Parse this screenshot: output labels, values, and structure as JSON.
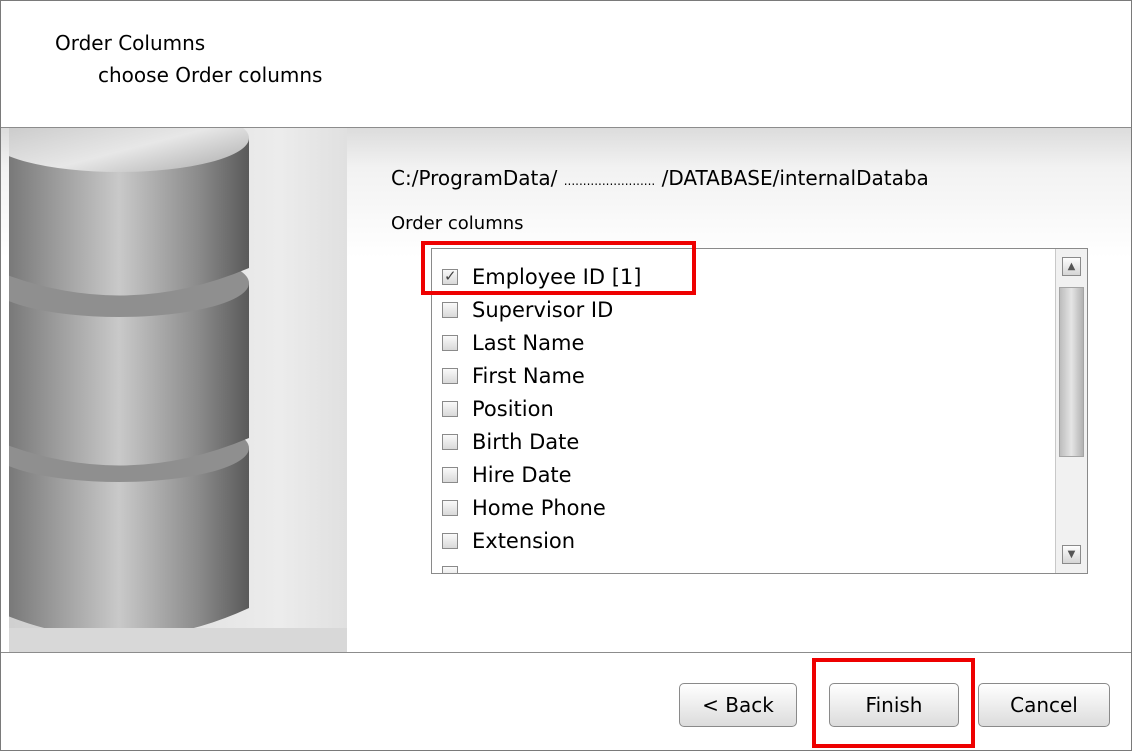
{
  "header": {
    "title": "Order Columns",
    "subtitle": "choose  Order columns"
  },
  "side_image": {
    "icon": "database-icon"
  },
  "path": {
    "prefix": "C:/ProgramData/",
    "redacted": "........................",
    "suffix": "/DATABASE/internalDataba"
  },
  "list": {
    "label": "Order columns",
    "items": [
      {
        "label": "Employee ID [1]",
        "checked": true
      },
      {
        "label": "Supervisor ID",
        "checked": false
      },
      {
        "label": "Last Name",
        "checked": false
      },
      {
        "label": "First Name",
        "checked": false
      },
      {
        "label": "Position",
        "checked": false
      },
      {
        "label": "Birth Date",
        "checked": false
      },
      {
        "label": "Hire Date",
        "checked": false
      },
      {
        "label": "Home Phone",
        "checked": false
      },
      {
        "label": "Extension",
        "checked": false
      }
    ]
  },
  "buttons": {
    "back": "< Back",
    "finish": "Finish",
    "cancel": "Cancel"
  },
  "colors": {
    "highlight": "#ee0000"
  }
}
